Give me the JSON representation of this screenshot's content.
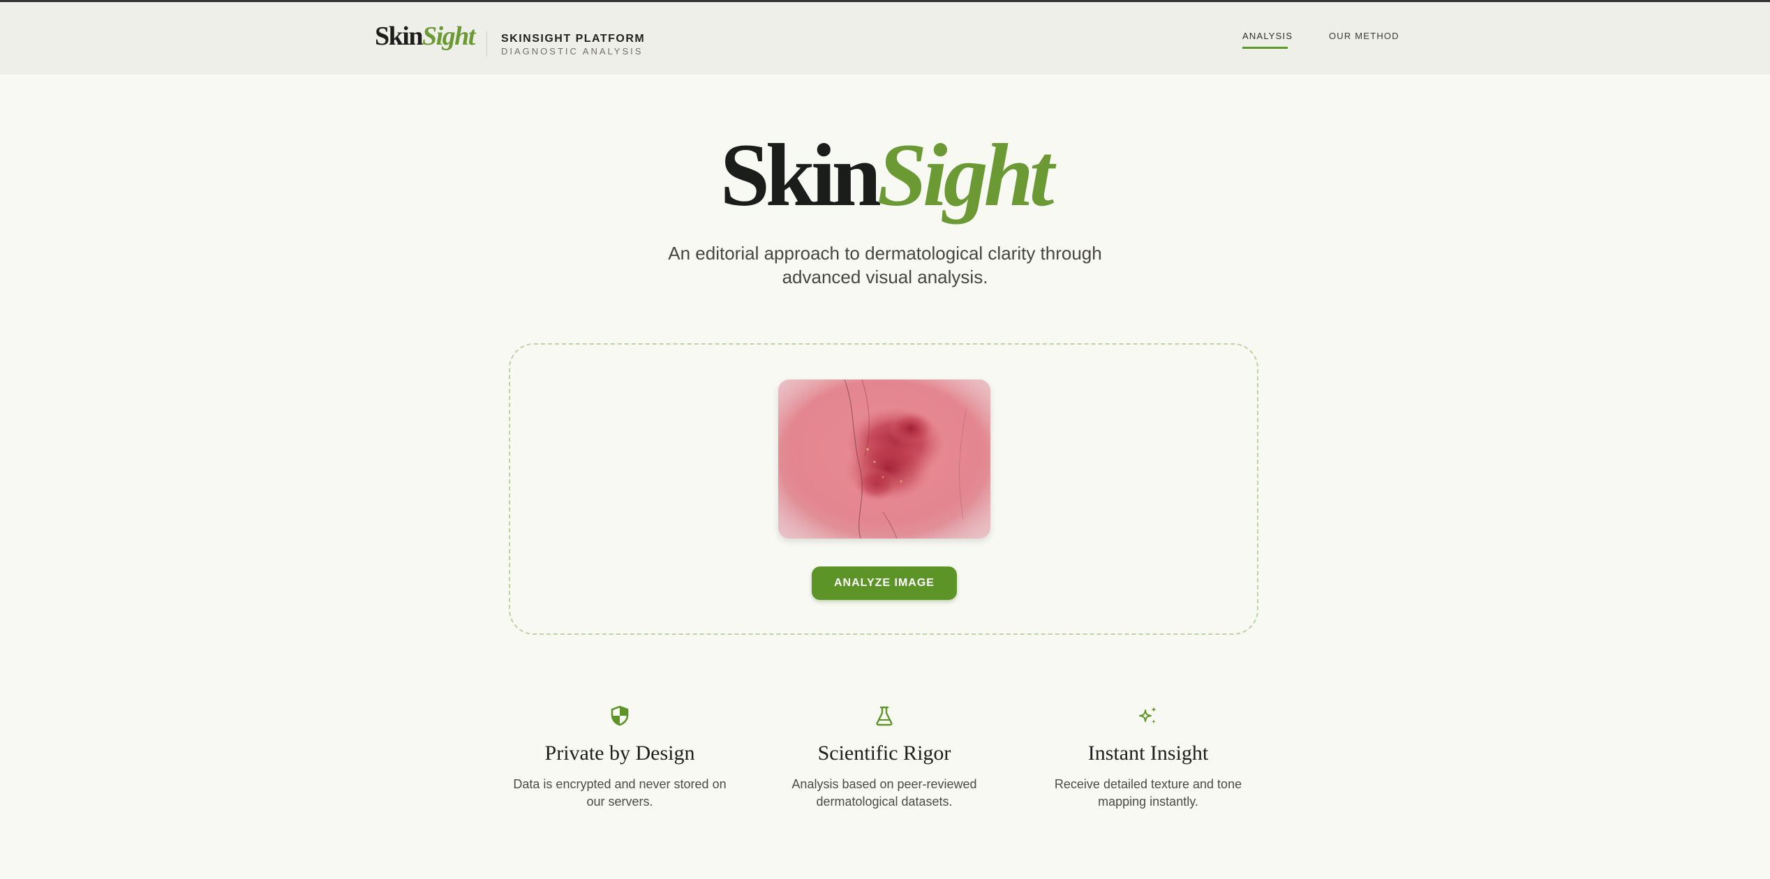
{
  "brand": {
    "logo_primary": "Skin",
    "logo_accent": "Sight",
    "platform": "SKINSIGHT PLATFORM",
    "subtitle": "DIAGNOSTIC ANALYSIS"
  },
  "nav": {
    "items": [
      {
        "label": "ANALYSIS",
        "active": true
      },
      {
        "label": "OUR METHOD",
        "active": false
      }
    ]
  },
  "hero": {
    "title_primary": "Skin",
    "title_accent": "Sight",
    "subtitle_line1": "An editorial approach to dermatological clarity through",
    "subtitle_line2": "advanced visual analysis."
  },
  "upload": {
    "image_icon": "skin-lesion-photo",
    "analyze_label": "ANALYZE IMAGE"
  },
  "features": [
    {
      "icon": "shield-icon",
      "title": "Private by Design",
      "desc_line1": "Data is encrypted and never stored on",
      "desc_line2": "our servers."
    },
    {
      "icon": "flask-icon",
      "title": "Scientific Rigor",
      "desc_line1": "Analysis based on peer-reviewed",
      "desc_line2": "dermatological datasets."
    },
    {
      "icon": "sparkles-icon",
      "title": "Instant Insight",
      "desc_line1": "Receive detailed texture and tone",
      "desc_line2": "mapping instantly."
    }
  ],
  "colors": {
    "accent": "#6b9a35",
    "button": "#5d9427",
    "background": "#f9f9f4",
    "header": "#efefe9"
  }
}
